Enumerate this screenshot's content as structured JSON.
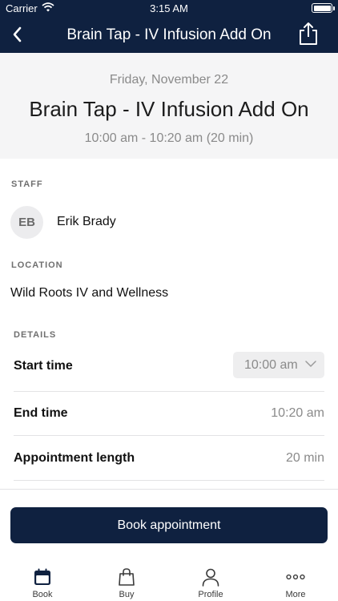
{
  "status_bar": {
    "carrier": "Carrier",
    "time": "3:15 AM"
  },
  "nav": {
    "title": "Brain Tap - IV Infusion Add On"
  },
  "header": {
    "date": "Friday, November 22",
    "service": "Brain Tap - IV Infusion Add On",
    "time_range": "10:00 am - 10:20 am (20 min)"
  },
  "staff": {
    "label": "STAFF",
    "initials": "EB",
    "name": "Erik Brady"
  },
  "location": {
    "label": "LOCATION",
    "name": "Wild Roots IV and Wellness"
  },
  "details": {
    "label": "DETAILS",
    "start_time_label": "Start time",
    "start_time_value": "10:00 am",
    "end_time_label": "End time",
    "end_time_value": "10:20 am",
    "length_label": "Appointment length",
    "length_value": "20 min"
  },
  "book_button": "Book appointment",
  "tabs": [
    {
      "label": "Book",
      "icon": "calendar-icon"
    },
    {
      "label": "Buy",
      "icon": "shopping-bag-icon"
    },
    {
      "label": "Profile",
      "icon": "person-icon"
    },
    {
      "label": "More",
      "icon": "more-dots-icon"
    }
  ],
  "colors": {
    "primary": "#0f2140",
    "muted_text": "#8a8a8a",
    "header_bg": "#f5f5f6"
  }
}
